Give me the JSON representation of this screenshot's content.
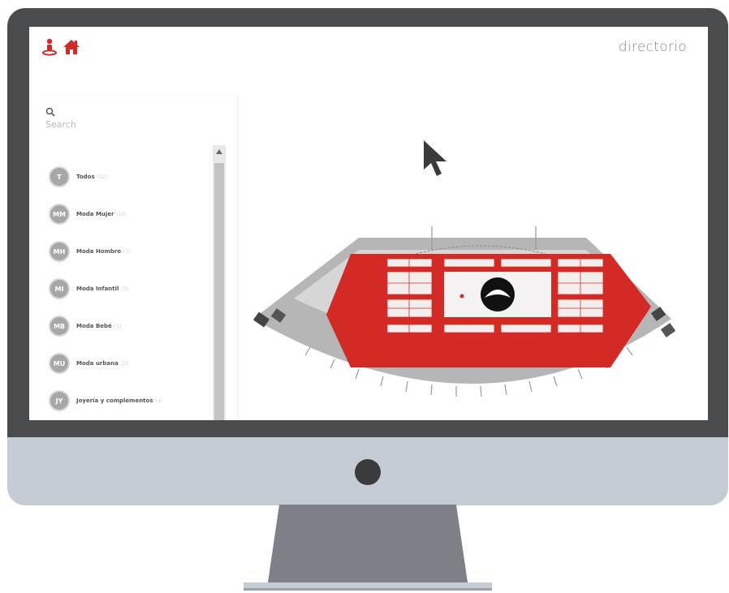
{
  "app": {
    "title": "directorio",
    "brand_color": "#d32a26"
  },
  "search": {
    "placeholder": "Search"
  },
  "categories": [
    {
      "initials": "T",
      "label": "Todos",
      "count": "(22)"
    },
    {
      "initials": "MM",
      "label": "Moda Mujer",
      "count": "(10)"
    },
    {
      "initials": "MH",
      "label": "Moda Hombre",
      "count": "(7)"
    },
    {
      "initials": "MI",
      "label": "Moda Infantil",
      "count": "(3)"
    },
    {
      "initials": "MB",
      "label": "Moda Bebé",
      "count": "(1)"
    },
    {
      "initials": "MU",
      "label": "Moda urbana",
      "count": "(2)"
    },
    {
      "initials": "JY",
      "label": "Joyería y complementos",
      "count": "(4)"
    }
  ],
  "icons": {
    "person": "person-pin-icon",
    "home": "home-icon",
    "search": "search-icon",
    "scroll_up": "scroll-up-arrow-icon",
    "cursor": "mouse-cursor-icon"
  }
}
